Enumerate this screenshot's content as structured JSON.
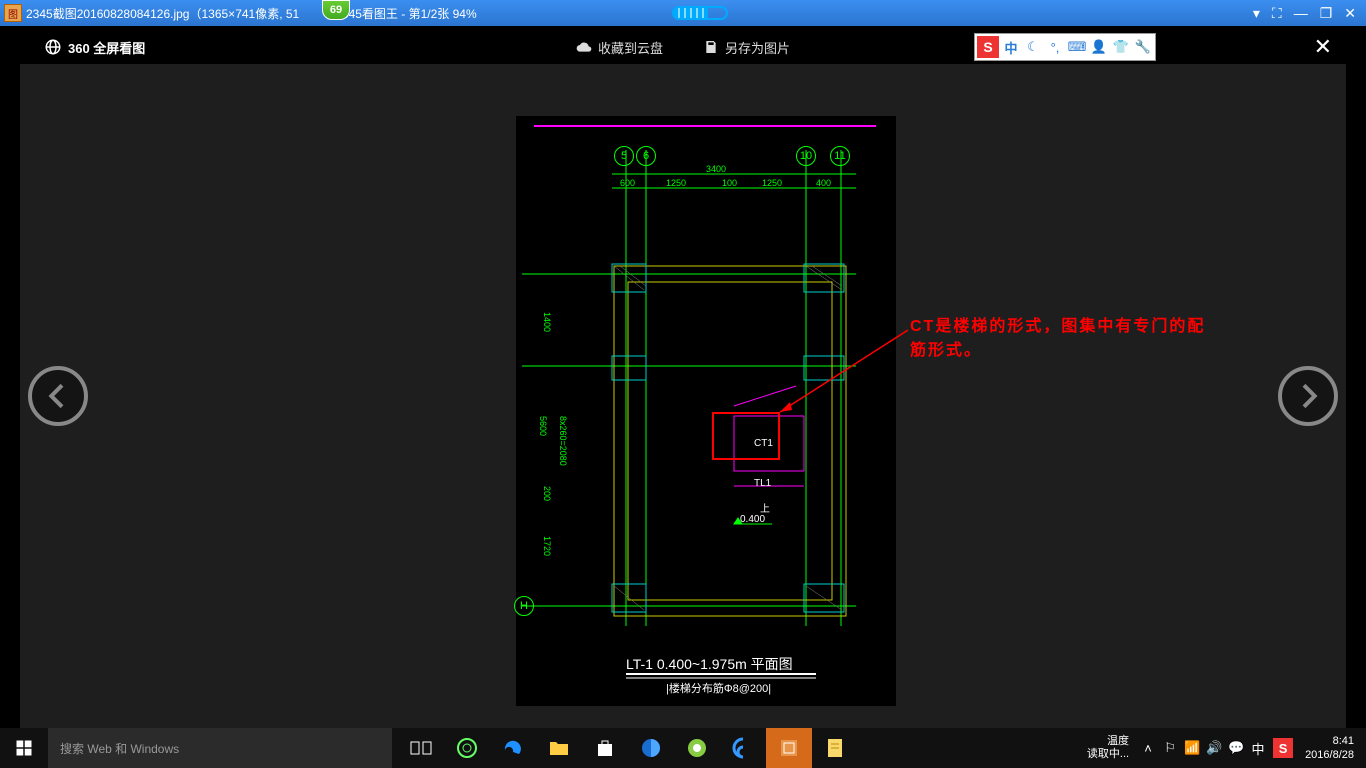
{
  "titlebar": {
    "filename": "2345截图20160828084126.jpg",
    "details": "（1365×741像素, 51",
    "app_suffix": "2345看图王 - 第1/2张 94%",
    "fps": "69"
  },
  "win": {
    "down": "▾",
    "full": "⛶",
    "min": "—",
    "max": "❐",
    "close": "✕"
  },
  "viewerbar": {
    "logo_text": "360 全屏看图",
    "save_cloud": "收藏到云盘",
    "save_as": "另存为图片"
  },
  "ime": {
    "logo": "S",
    "zhong": "中"
  },
  "cad": {
    "grid_marks": {
      "c5": "5",
      "c6": "6",
      "c10": "10",
      "c11": "11",
      "cH": "H"
    },
    "dims_top": {
      "d1": "600",
      "d2": "1250",
      "d3": "100",
      "d4": "1250",
      "d5": "400",
      "total": "3400"
    },
    "dims_left": {
      "d1": "1400",
      "d2": "8x260=2080",
      "d3": "5600",
      "d4": "200",
      "d5": "1720"
    },
    "labels": {
      "ct1": "CT1",
      "tl1": "TL1",
      "shang": "上",
      "lev": "0.400"
    },
    "title": "LT-1 0.400~1.975m 平面图",
    "subtitle": "|楼梯分布筋Φ8@200|"
  },
  "annotation": {
    "line1": "CT是楼梯的形式，图集中有专门的配",
    "line2": "筋形式。"
  },
  "taskbar": {
    "search_placeholder": "搜索 Web 和 Windows",
    "status_top": "温度",
    "status_bottom": "读取中...",
    "lang": "中",
    "time": "8:41",
    "date": "2016/8/28"
  }
}
